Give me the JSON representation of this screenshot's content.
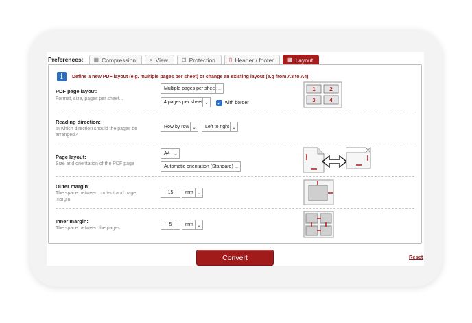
{
  "preferences_label": "Preferences:",
  "tabs": [
    {
      "label": "Compression",
      "icon": "compression-icon",
      "active": false
    },
    {
      "label": "View",
      "icon": "view-icon",
      "active": false
    },
    {
      "label": "Protection",
      "icon": "lock-icon",
      "active": false
    },
    {
      "label": "Header / footer",
      "icon": "document-icon",
      "active": false
    },
    {
      "label": "Layout",
      "icon": "grid-icon",
      "active": true
    }
  ],
  "info_text": "Define a new PDF layout (e.g. multiple pages per sheet) or change an existing layout (e.g from A3 to A4).",
  "pdf_page_layout": {
    "title": "PDF page layout:",
    "description": "Format, size, pages per sheet...",
    "mode_value": "Multiple pages per sheet",
    "pages_value": "4 pages per sheet",
    "with_border_label": "with border",
    "with_border_checked": true,
    "preview_numbers": [
      "1",
      "2",
      "3",
      "4"
    ]
  },
  "reading_direction": {
    "title": "Reading direction:",
    "description": "In which direction should the pages be arranged?",
    "order_value": "Row by row",
    "direction_value": "Left to right"
  },
  "page_layout": {
    "title": "Page layout:",
    "description": "Size and orientation of the PDF page",
    "size_value": "A4",
    "orientation_value": "Automatic orientation (Standard)"
  },
  "outer_margin": {
    "title": "Outer margin:",
    "description": "The space between content and page margin",
    "value": "15",
    "unit": "mm"
  },
  "inner_margin": {
    "title": "Inner margin:",
    "description": "The space between the pages",
    "value": "5",
    "unit": "mm"
  },
  "convert_label": "Convert",
  "reset_label": "Reset",
  "colors": {
    "accent": "#a51d1d",
    "info_icon": "#2d6fbf",
    "checkbox": "#2b6cc7"
  }
}
